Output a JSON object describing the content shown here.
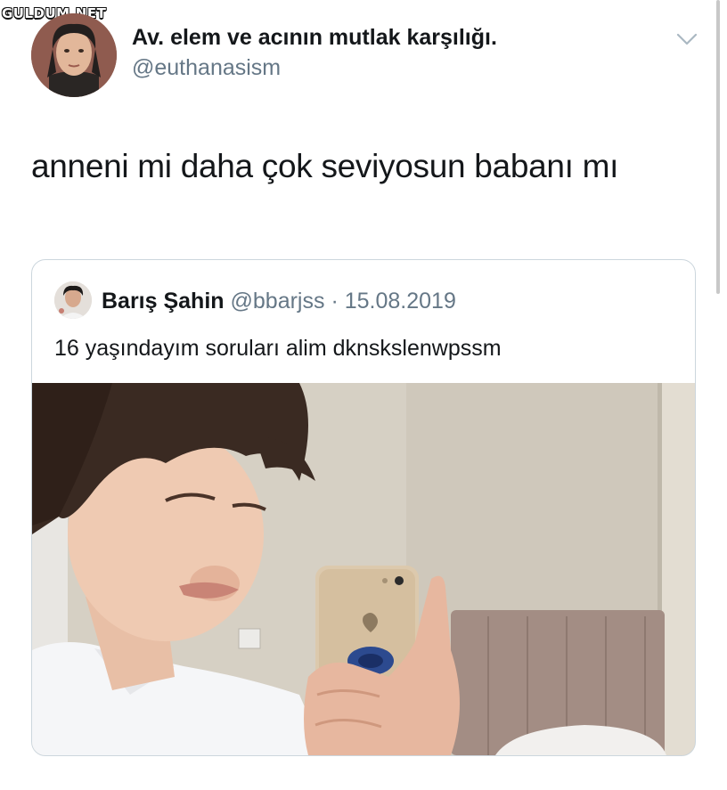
{
  "watermark": {
    "text": "GULDUM.NET"
  },
  "tweet": {
    "display_name": "Av. elem ve acının mutlak karşılığı.",
    "handle": "@euthanasism",
    "text": "anneni mi daha çok seviyosun babanı mı",
    "menu_icon": "chevron-down-icon"
  },
  "quoted_tweet": {
    "display_name": "Barış Şahin",
    "handle": "@bbarjss",
    "separator": "·",
    "date": "15.08.2019",
    "text": "16 yaşındayım soruları alim dknskslenwpssm",
    "media": "mirror-selfie-photo"
  },
  "colors": {
    "text_primary": "#14171a",
    "text_secondary": "#657786",
    "border": "#ccd6dd",
    "background": "#ffffff"
  }
}
